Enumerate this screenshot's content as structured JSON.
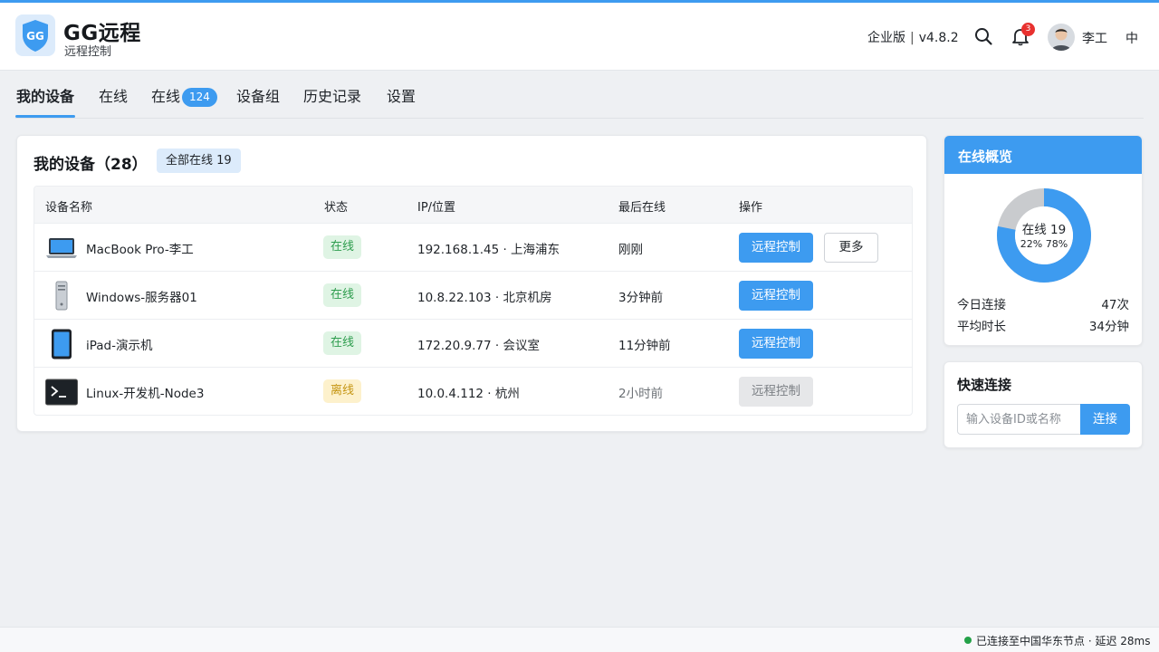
{
  "app": {
    "logo_text": "GG",
    "title": "GG远程",
    "subtitle": "远程控制",
    "edition": "企业版",
    "version": "v4.8.2",
    "notification_count": "3",
    "user_name": "李工",
    "language": "中",
    "accent_color": "#3d9bf0"
  },
  "tabs": [
    {
      "label": "我的设备",
      "active": true
    },
    {
      "label": "在线"
    },
    {
      "label": "在线",
      "count": "124"
    },
    {
      "label": "设备组"
    },
    {
      "label": "历史记录"
    },
    {
      "label": "设置"
    }
  ],
  "devices": {
    "title": "我的设备（28）",
    "online_pill": "全部在线 19",
    "columns": [
      "设备名称",
      "状态",
      "IP/位置",
      "最后在线",
      "操作"
    ],
    "rows": [
      {
        "icon": "laptop-icon",
        "name": "MacBook Pro-李工",
        "status": "在线",
        "status_type": "online",
        "ip": "192.168.1.45 · 上海浦东",
        "last_seen": "刚刚",
        "action": "远程控制",
        "more": "更多"
      },
      {
        "icon": "server-icon",
        "name": "Windows-服务器01",
        "status": "在线",
        "status_type": "online",
        "ip": "10.8.22.103 · 北京机房",
        "last_seen": "3分钟前",
        "action": "远程控制"
      },
      {
        "icon": "tablet-icon",
        "name": "iPad-演示机",
        "status": "在线",
        "status_type": "online",
        "ip": "172.20.9.77 · 会议室",
        "last_seen": "11分钟前",
        "action": "远程控制"
      },
      {
        "icon": "terminal-icon",
        "name": "Linux-开发机-Node3",
        "status": "离线",
        "status_type": "offline",
        "ip": "10.0.4.112 · 杭州",
        "last_seen": "2小时前",
        "action": "远程控制"
      }
    ]
  },
  "overview": {
    "title": "在线概览",
    "center_label": "在线 19",
    "pct_offline": "22%",
    "pct_online": "78%",
    "online_fraction": 0.78,
    "stats": [
      {
        "label": "今日连接",
        "value": "47次"
      },
      {
        "label": "平均时长",
        "value": "34分钟"
      }
    ]
  },
  "quick_connect": {
    "title": "快速连接",
    "placeholder": "输入设备ID或名称",
    "button": "连接"
  },
  "statusbar": {
    "text": "已连接至中国华东节点 · 延迟 28ms"
  }
}
